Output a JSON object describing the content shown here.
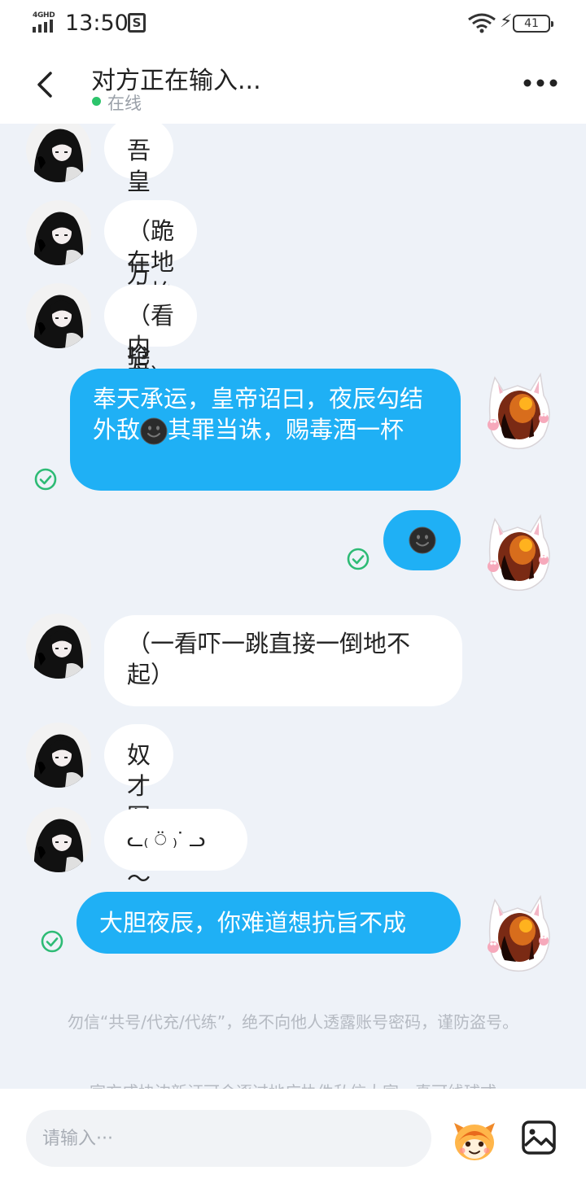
{
  "status_bar": {
    "network": "4GHD",
    "time": "13:50",
    "battery": "41"
  },
  "header": {
    "title": "对方正在输入...",
    "status": "在线",
    "back_icon": "chevron-left-icon",
    "more_icon": "more-horizontal-icon"
  },
  "messages": [
    {
      "side": "in",
      "text": "吾皇万岁万岁万万岁"
    },
    {
      "side": "in",
      "text": "（跪在地上抬起头抢旨）"
    },
    {
      "side": "in",
      "text": "（看内容）"
    },
    {
      "side": "out",
      "text_before": "奉天承运，皇帝诏曰，夜辰勾结外敌",
      "emoji": "dark-smile-emoji",
      "text_after": "其罪当诛，赐毒酒一杯"
    },
    {
      "side": "out",
      "emoji": "dark-smile-emoji"
    },
    {
      "side": "in",
      "text": "（一看吓一跳直接一倒地不起）"
    },
    {
      "side": "in",
      "text": "奴才冤枉～皇上"
    },
    {
      "side": "in",
      "text": "ᓚ₍ ⍥ ₎ᐝ ᓗ"
    },
    {
      "side": "out",
      "text": "大胆夜辰，你难道想抗旨不成"
    }
  ],
  "notice": {
    "text": "勿信“共号/代充/代练”，绝不向他人透露账号密码，谨防盗号。",
    "text2": "官方成块边新证可会逐过地广执件私信大家，真可线球式"
  },
  "input": {
    "placeholder": "请输入···"
  },
  "colors": {
    "outgoing_bubble": "#1fb0f5",
    "incoming_bubble": "#ffffff",
    "background": "#eef2f8",
    "online": "#2cc46b",
    "read_check": "#2dbb75"
  }
}
